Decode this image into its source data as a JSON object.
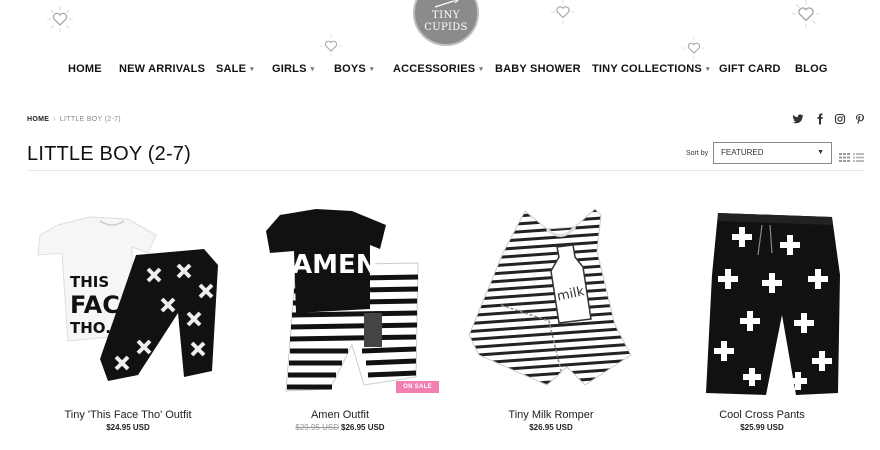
{
  "logo": {
    "line1": "TINY",
    "line2": "CUPIDS",
    "icon": "tiny-cupids-logo"
  },
  "nav": {
    "items": [
      {
        "label": "HOME"
      },
      {
        "label": "NEW ARRIVALS"
      },
      {
        "label": "SALE",
        "dropdown": true
      },
      {
        "label": "GIRLS",
        "dropdown": true
      },
      {
        "label": "BOYS",
        "dropdown": true
      },
      {
        "label": "ACCESSORIES",
        "dropdown": true
      },
      {
        "label": "BABY SHOWER"
      },
      {
        "label": "TINY COLLECTIONS",
        "dropdown": true
      },
      {
        "label": "GIFT CARD"
      },
      {
        "label": "BLOG"
      }
    ],
    "caret": "▾"
  },
  "breadcrumb": {
    "home": "HOME",
    "separator": "›",
    "current": "LITTLE BOY (2-7)"
  },
  "social": [
    "twitter-icon",
    "facebook-icon",
    "instagram-icon",
    "pinterest-icon"
  ],
  "page": {
    "title": "LITTLE BOY (2-7)"
  },
  "sort": {
    "label": "Sort by",
    "value": "FEATURED",
    "arrow": "▼"
  },
  "products": [
    {
      "name": "Tiny 'This Face Tho' Outfit",
      "price": "$24.95 USD",
      "image_text": [
        "THIS",
        "FACE",
        "THO."
      ]
    },
    {
      "name": "Amen Outfit",
      "old_price": "$29.95 USD",
      "price": "$26.95 USD",
      "badge": "ON SALE",
      "image_text": "AMEN."
    },
    {
      "name": "Tiny Milk Romper",
      "price": "$26.95 USD",
      "image_text": "milk"
    },
    {
      "name": "Cool Cross Pants",
      "price": "$25.99 USD"
    }
  ],
  "colors": {
    "badge": "#f27fb2",
    "logo": "#8b8b8b",
    "text": "#111111"
  }
}
